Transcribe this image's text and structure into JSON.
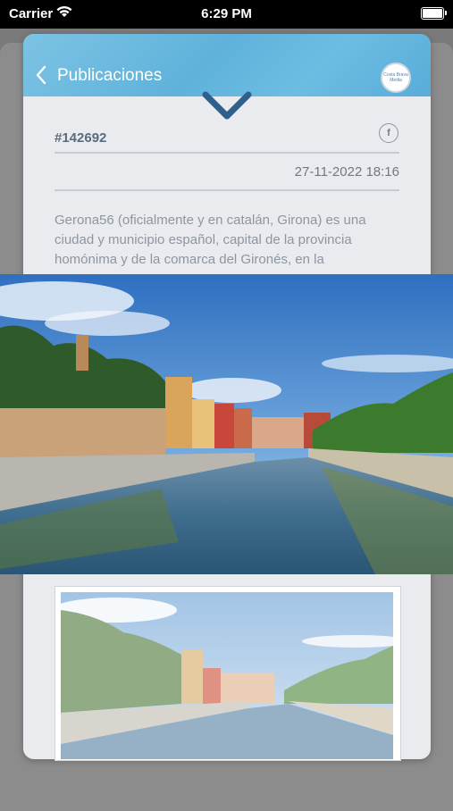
{
  "status_bar": {
    "carrier": "Carrier",
    "time": "6:29 PM",
    "battery_level": 1.0
  },
  "nav": {
    "title": "Publicaciones",
    "logo_text": "Costa Brava Media"
  },
  "post": {
    "reference": "#142692",
    "share_icon_text": "f",
    "date": "27-11-2022 18:16",
    "body": "Gerona56 (oficialmente y en catalán, Girona) es una ciudad y municipio español, capital de la provincia homónima y de la comarca del Gironés, en la"
  },
  "colors": {
    "nav_gradient": "#6cbde2",
    "chevron": "#2f5f8a",
    "card_bg": "#e9ebee"
  },
  "icons": {
    "back": "chevron-left-icon",
    "collapse": "chevron-down-icon",
    "share": "facebook-icon",
    "wifi": "wifi-icon",
    "battery": "battery-icon"
  }
}
